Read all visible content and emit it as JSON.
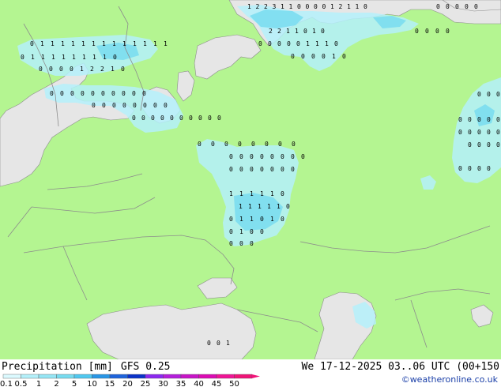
{
  "footer": {
    "title": "Precipitation [mm]",
    "model": "GFS 0.25",
    "datetime": "We 17-12-2025 03..06 UTC (00+150",
    "credit": "©weatheronline.co.uk"
  },
  "legend": {
    "labels": [
      "0.1",
      "0.5",
      "1",
      "2",
      "5",
      "10",
      "15",
      "20",
      "25",
      "30",
      "35",
      "40",
      "45",
      "50"
    ],
    "colors": [
      "#dcfaff",
      "#b4f0fa",
      "#96e6f5",
      "#78dcf0",
      "#50c8f0",
      "#2896e6",
      "#1e64dc",
      "#0a32c8",
      "#8c28f0",
      "#b41edc",
      "#c814c8",
      "#dc0ab4",
      "#f01496",
      "#f01478"
    ]
  },
  "map": {
    "land_color": "#b4f591",
    "sea_color": "#e6e6e6",
    "precip_light": "#b4f0fa",
    "precip_medium": "#78dcf0",
    "border_color": "#8c8c8c",
    "station_rows": [
      {
        "id": "r1",
        "values": [
          "1",
          "2",
          "2",
          "3",
          "1",
          "1",
          "0",
          "0",
          "0",
          "0",
          "1",
          "2",
          "1",
          "1",
          "0"
        ]
      },
      {
        "id": "r2",
        "values": [
          "2",
          "2",
          "1",
          "1",
          "0",
          "1",
          "0"
        ]
      },
      {
        "id": "r3",
        "values": [
          "0",
          "0",
          "0",
          "0",
          "0",
          "1",
          "1",
          "1",
          "0"
        ]
      },
      {
        "id": "r4",
        "values": [
          "0",
          "0",
          "0",
          "0",
          "1",
          "0"
        ]
      },
      {
        "id": "r5",
        "values": [
          "0",
          "1",
          "1",
          "1",
          "1",
          "1",
          "1",
          "1",
          "1",
          "1",
          "1",
          "1",
          "1",
          "1"
        ]
      },
      {
        "id": "r6",
        "values": [
          "0",
          "1",
          "1",
          "1",
          "1",
          "1",
          "1",
          "1",
          "1",
          "0"
        ]
      },
      {
        "id": "r7",
        "values": [
          "0",
          "0",
          "0",
          "0",
          "1",
          "2",
          "2",
          "1",
          "0"
        ]
      },
      {
        "id": "r8",
        "values": [
          "0",
          "0",
          "0",
          "0",
          "0",
          "0",
          "0",
          "0",
          "0",
          "0"
        ]
      },
      {
        "id": "r9",
        "values": [
          "0",
          "0",
          "0",
          "0",
          "0",
          "0",
          "0",
          "0"
        ]
      },
      {
        "id": "r10",
        "values": [
          "0",
          "0",
          "0",
          "0",
          "0",
          "0",
          "0",
          "0",
          "0",
          "0"
        ]
      },
      {
        "id": "r11",
        "values": [
          "0",
          "0",
          "0",
          "0",
          "0",
          "0",
          "0",
          "0"
        ]
      },
      {
        "id": "r12",
        "values": [
          "0",
          "0",
          "0",
          "0",
          "0",
          "0",
          "0"
        ]
      },
      {
        "id": "r13",
        "values": [
          "1",
          "1",
          "1",
          "1",
          "1",
          "0"
        ]
      },
      {
        "id": "r14",
        "values": [
          "1",
          "1",
          "1",
          "1",
          "1",
          "0"
        ]
      },
      {
        "id": "r15",
        "values": [
          "0",
          "1",
          "1",
          "0",
          "1",
          "0"
        ]
      },
      {
        "id": "r16",
        "values": [
          "0",
          "1",
          "0",
          "0"
        ]
      },
      {
        "id": "r17",
        "values": [
          "0",
          "0",
          "0"
        ]
      },
      {
        "id": "r18",
        "values": [
          "0",
          "0",
          "0",
          "0",
          "0",
          "0"
        ]
      },
      {
        "id": "r19",
        "values": [
          "0",
          "0",
          "0",
          "0",
          "0",
          "0"
        ]
      },
      {
        "id": "r20",
        "values": [
          "0",
          "0",
          "0",
          "0"
        ]
      },
      {
        "id": "r21",
        "values": [
          "0",
          "0",
          "0",
          "0"
        ]
      },
      {
        "id": "r22",
        "values": [
          "0",
          "0",
          "0"
        ]
      },
      {
        "id": "r23",
        "values": [
          "0",
          "0",
          "0",
          "0"
        ]
      },
      {
        "id": "r24",
        "values": [
          "0",
          "0",
          "0",
          "0",
          "0"
        ]
      },
      {
        "id": "r25",
        "values": [
          "0",
          "0",
          "0",
          "0",
          "0",
          "0",
          "0",
          "0"
        ]
      },
      {
        "id": "r26",
        "values": [
          "0",
          "0",
          "1"
        ]
      }
    ]
  }
}
